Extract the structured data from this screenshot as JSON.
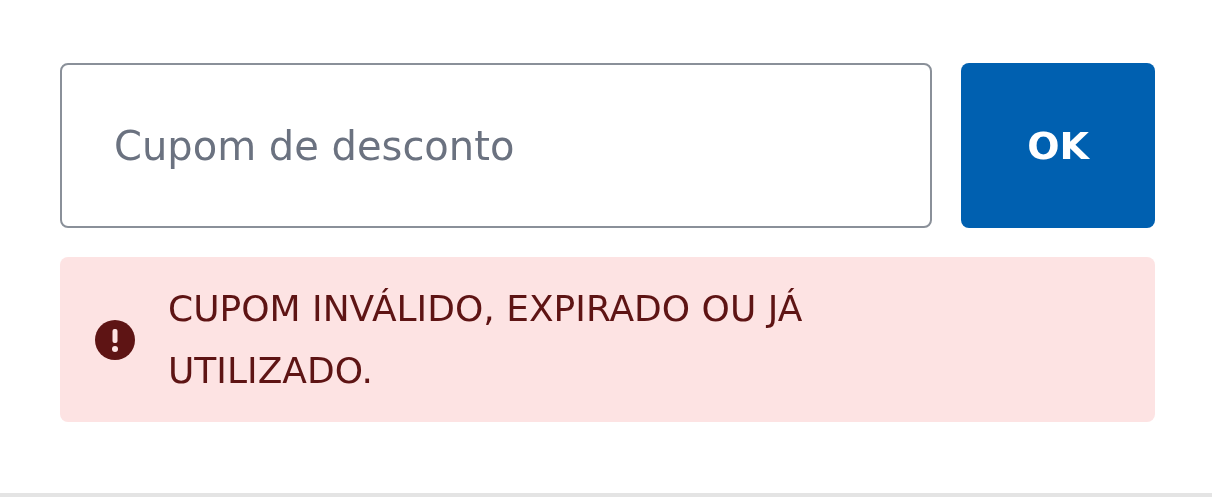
{
  "coupon": {
    "placeholder": "Cupom de desconto",
    "button": "OK"
  },
  "alert": {
    "kind": "error",
    "message": "CUPOM INVÁLIDO, EXPIRADO OU JÁ UTILIZADO."
  }
}
